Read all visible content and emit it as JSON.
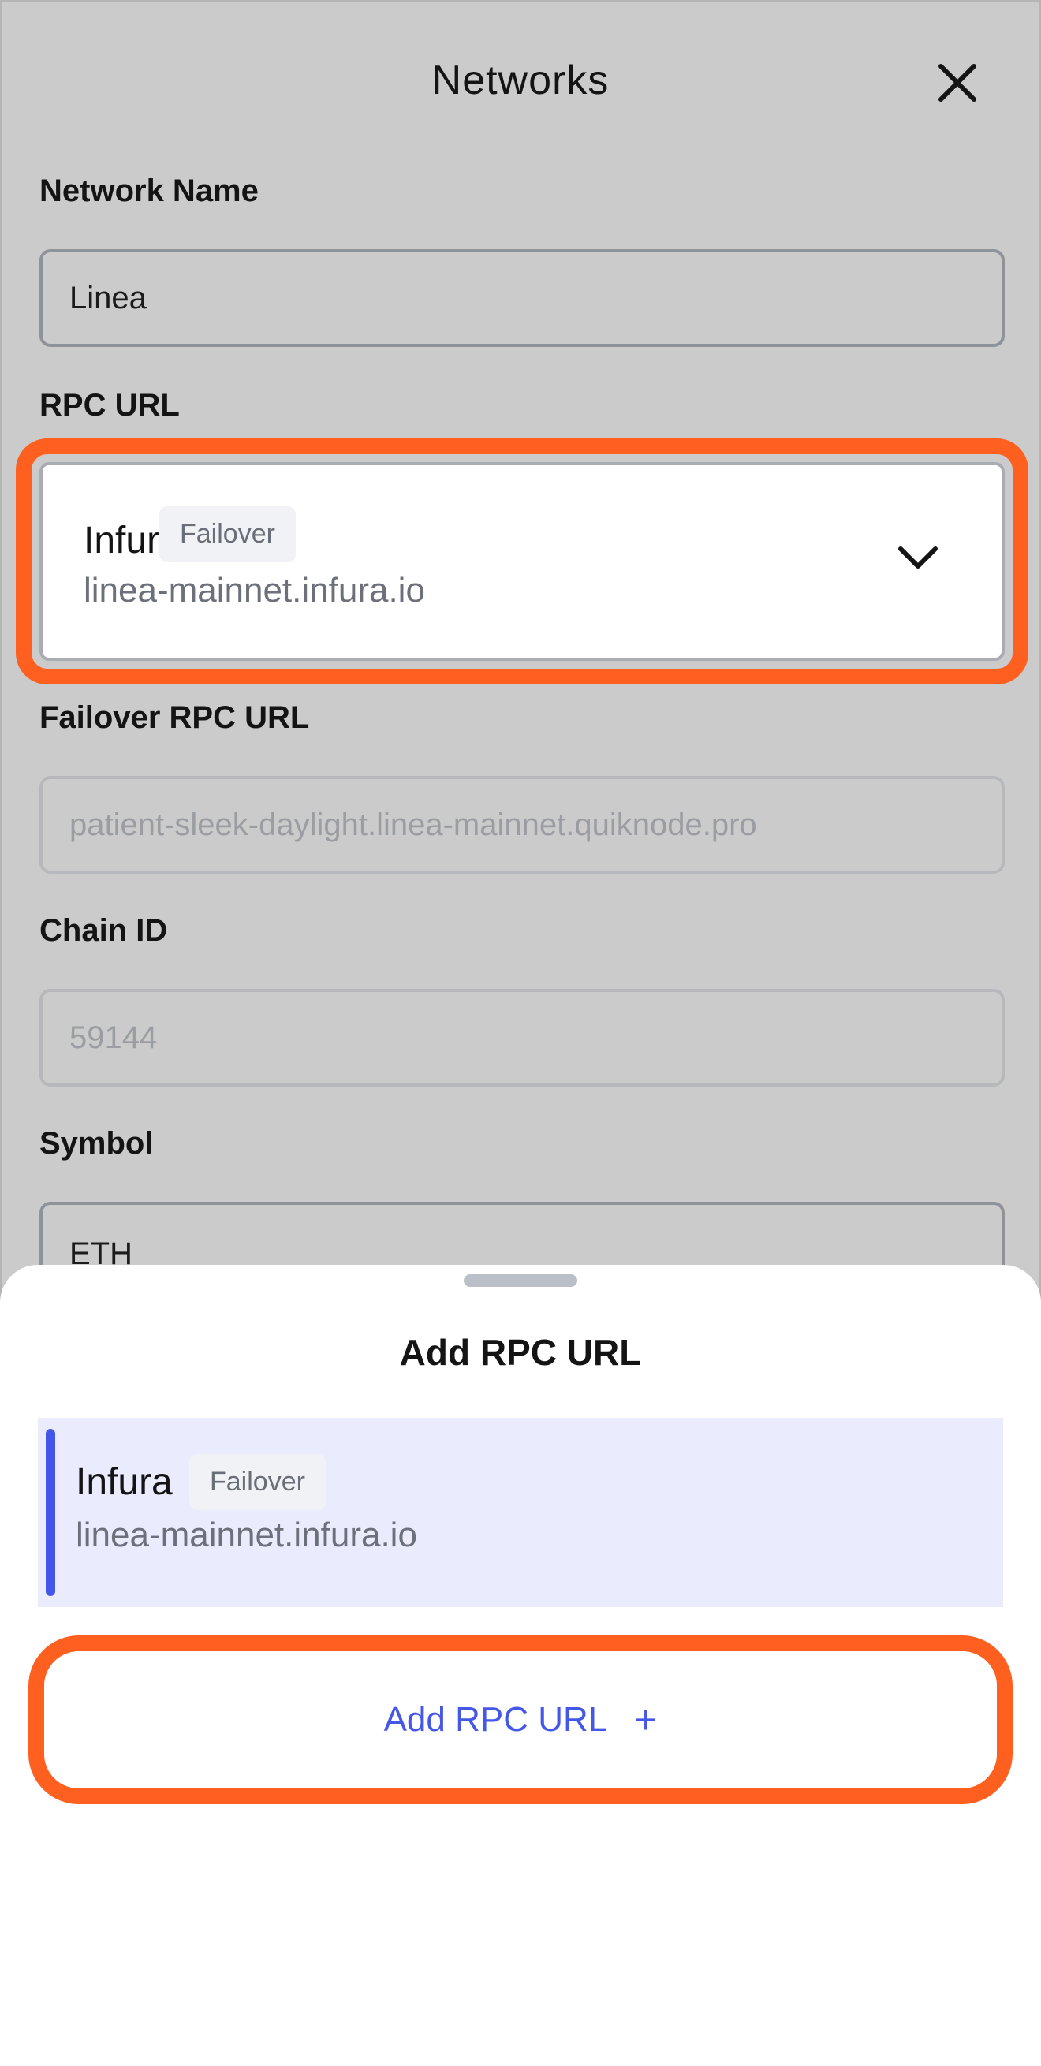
{
  "header": {
    "title": "Networks",
    "close_icon": "close-icon"
  },
  "form": {
    "network_name": {
      "label": "Network Name",
      "value": "Linea"
    },
    "rpc_url": {
      "label": "RPC URL",
      "name": "Infura",
      "badge": "Failover",
      "url": "linea-mainnet.infura.io",
      "icon": "chevron-down-icon"
    },
    "failover_rpc_url": {
      "label": "Failover RPC URL",
      "value": "patient-sleek-daylight.linea-mainnet.quiknode.pro"
    },
    "chain_id": {
      "label": "Chain ID",
      "value": "59144"
    },
    "symbol": {
      "label": "Symbol",
      "value": "ETH"
    }
  },
  "sheet": {
    "title": "Add RPC URL",
    "items": [
      {
        "name": "Infura",
        "badge": "Failover",
        "url": "linea-mainnet.infura.io",
        "selected": true
      }
    ],
    "add_button": {
      "label": "Add RPC URL",
      "icon": "plus-icon"
    }
  },
  "colors": {
    "highlight": "#ff5f1f",
    "accent": "#4457e6",
    "selected_bg": "#eaecfd",
    "overlay": "#cbcbcb"
  }
}
